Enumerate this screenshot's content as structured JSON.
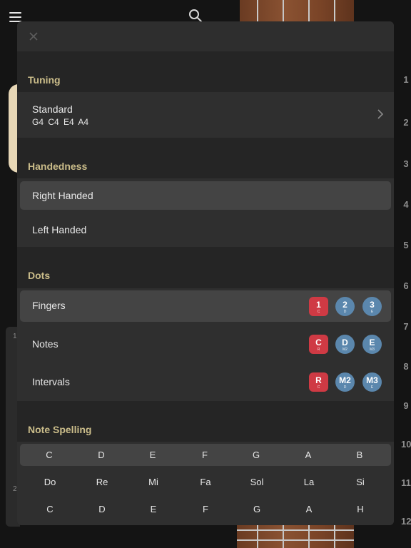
{
  "background": {
    "fret_numbers": [
      "1",
      "2",
      "3",
      "4",
      "5",
      "6",
      "7",
      "8",
      "9",
      "10",
      "11",
      "12"
    ],
    "left_card_numbers": [
      "1",
      "2"
    ]
  },
  "modal": {
    "tuning": {
      "title": "Tuning",
      "name": "Standard",
      "notes": "G4 C4 E4 A4"
    },
    "handedness": {
      "title": "Handedness",
      "options": [
        {
          "label": "Right Handed",
          "selected": true
        },
        {
          "label": "Left Handed",
          "selected": false
        }
      ]
    },
    "dots": {
      "title": "Dots",
      "options": [
        {
          "label": "Fingers",
          "selected": true,
          "badges": [
            {
              "main": "1",
              "sub": "C"
            },
            {
              "main": "2",
              "sub": "D"
            },
            {
              "main": "3",
              "sub": "E"
            }
          ]
        },
        {
          "label": "Notes",
          "selected": false,
          "badges": [
            {
              "main": "C",
              "sub": "R"
            },
            {
              "main": "D",
              "sub": "M2"
            },
            {
              "main": "E",
              "sub": "M3"
            }
          ]
        },
        {
          "label": "Intervals",
          "selected": false,
          "badges": [
            {
              "main": "R",
              "sub": "C"
            },
            {
              "main": "M2",
              "sub": "D"
            },
            {
              "main": "M3",
              "sub": "E"
            }
          ]
        }
      ]
    },
    "note_spelling": {
      "title": "Note Spelling",
      "rows": [
        {
          "selected": true,
          "notes": [
            "C",
            "D",
            "E",
            "F",
            "G",
            "A",
            "B"
          ]
        },
        {
          "selected": false,
          "notes": [
            "Do",
            "Re",
            "Mi",
            "Fa",
            "Sol",
            "La",
            "Si"
          ]
        },
        {
          "selected": false,
          "notes": [
            "C",
            "D",
            "E",
            "F",
            "G",
            "A",
            "H"
          ]
        }
      ]
    }
  },
  "colors": {
    "section_title": "#cbbd8a",
    "badge_red": "#cf3a44",
    "badge_blue": "#5b87ad",
    "selected_row": "#444444"
  },
  "icons": [
    "menu-icon",
    "search-icon",
    "close-icon",
    "chevron-right-icon"
  ]
}
